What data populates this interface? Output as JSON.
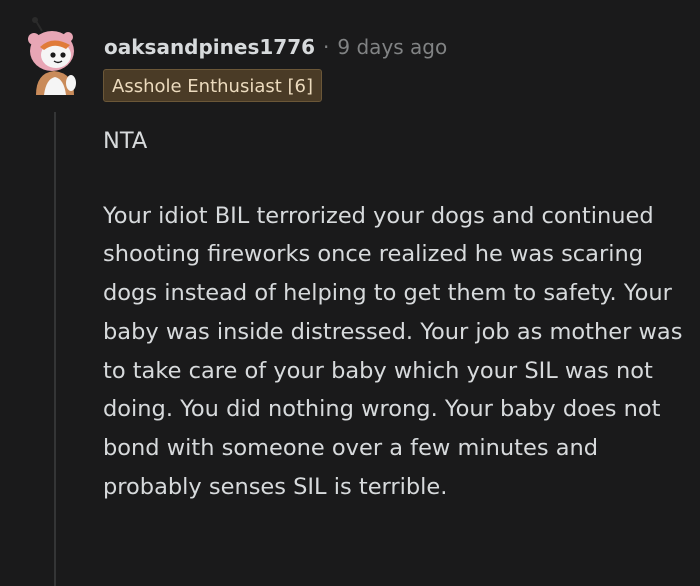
{
  "comment": {
    "username": "oaksandpines1776",
    "separator": "·",
    "timestamp": "9 days ago",
    "flair": "Asshole Enthusiast [6]",
    "paragraphs": [
      "NTA",
      "Your idiot BIL terrorized your dogs and continued shooting fireworks once realized he was scaring dogs instead of helping to get them to safety. Your baby was inside distressed. Your job as mother was to take care of your baby which your SIL was not doing. You did nothing wrong. Your baby does not bond with someone over a few minutes and probably senses SIL is terrible."
    ]
  },
  "colors": {
    "background": "#1a1a1b",
    "text": "#d7dadc",
    "muted": "#818384",
    "flair_bg": "#4a3b26",
    "flair_text": "#ecdbbe",
    "avatar_hair": "#e8a6b5",
    "avatar_skin": "#f5f5f5"
  },
  "icons": {
    "avatar": "snoo-avatar-icon"
  }
}
